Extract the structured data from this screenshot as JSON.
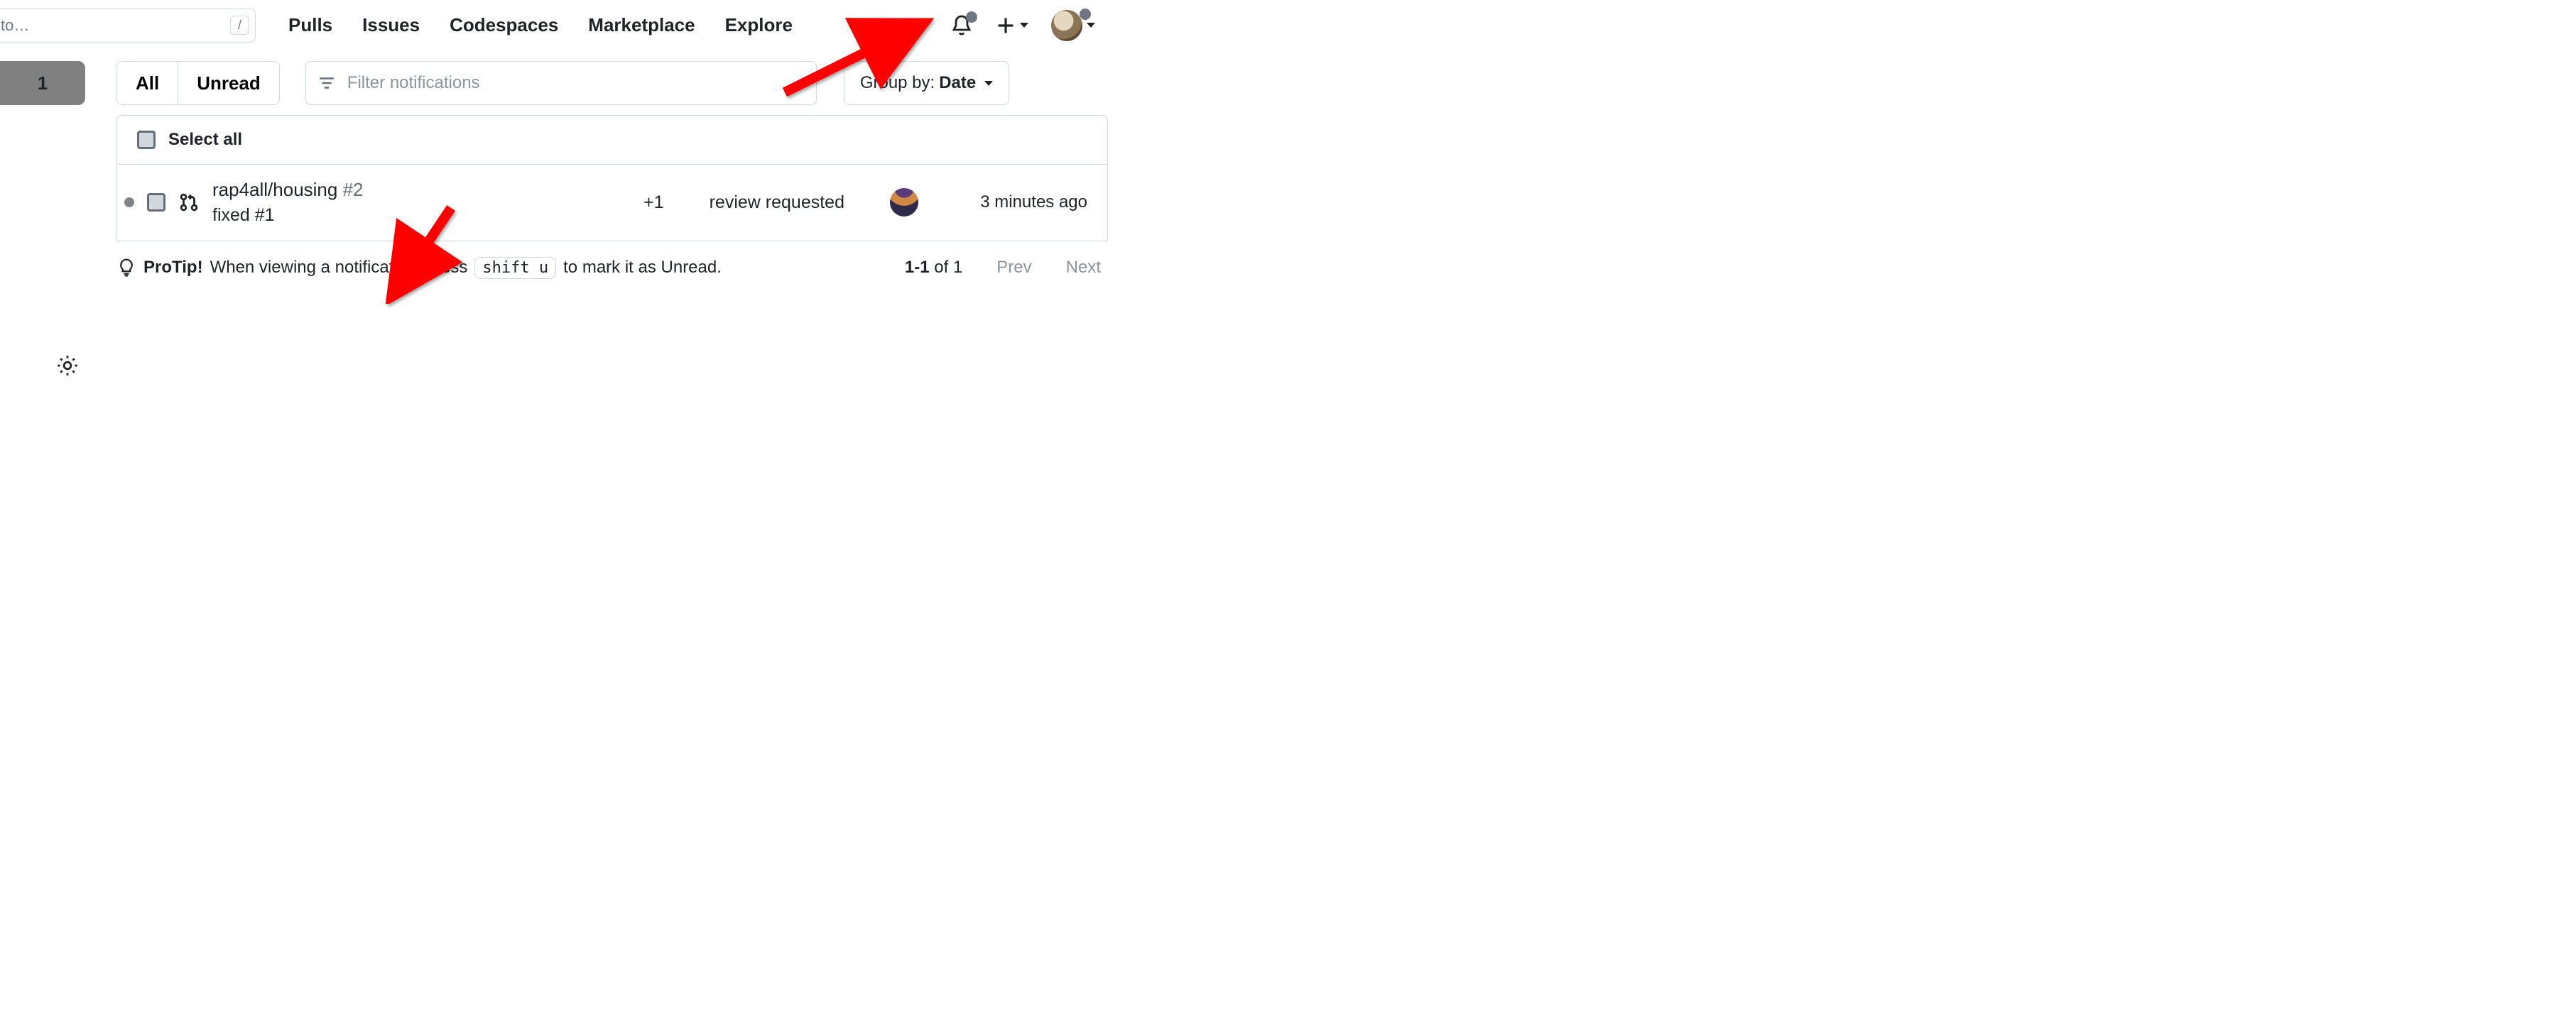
{
  "topnav": {
    "search_text": "to…",
    "slash": "/",
    "links": [
      "Pulls",
      "Issues",
      "Codespaces",
      "Marketplace",
      "Explore"
    ]
  },
  "toolbar": {
    "count": "1",
    "seg_all": "All",
    "seg_unread": "Unread",
    "filter_placeholder": "Filter notifications",
    "groupby_prefix": "Group by:",
    "groupby_value": "Date"
  },
  "list": {
    "select_all": "Select all",
    "row": {
      "repo": "rap4all/housing",
      "ref": "#2",
      "title": "fixed #1",
      "extra_count": "+1",
      "reason": "review requested",
      "time": "3 minutes ago"
    }
  },
  "footer": {
    "protip_label": "ProTip!",
    "protip_text_1": "When viewing a notification, press",
    "kbd": "shift u",
    "protip_text_2": "to mark it as Unread.",
    "range": "1-1",
    "range_of": " of 1",
    "prev": "Prev",
    "next": "Next"
  }
}
